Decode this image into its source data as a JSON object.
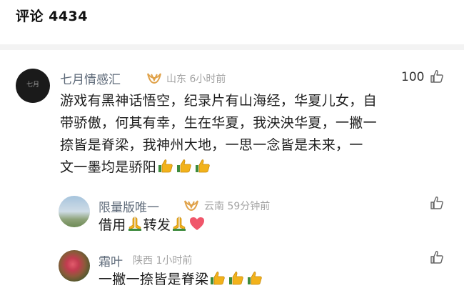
{
  "header": {
    "title": "评论 4434"
  },
  "icons": {
    "vip": "vip-badge-icon",
    "like": "thumbs-up-icon",
    "clap": "thumbs-up-emoji",
    "pray": "pray-emoji",
    "heart": "heart-emoji"
  },
  "comments": [
    {
      "avatar_text": "七月",
      "name": "七月情感汇",
      "location_time": "山东 6小时前",
      "likes": "100",
      "lines": [
        "游戏有黑神话悟空，纪录片有山海经，华夏儿女，自",
        "带骄傲，何其有幸，生在华夏，我泱泱华夏，一撇一",
        "捺皆是脊梁，我神州大地，一思一念皆是未来，一",
        "文一墨均是骄阳"
      ]
    },
    {
      "name": "限量版唯一",
      "location_time": "云南 59分钟前",
      "text_a": "借用",
      "text_b": "转发"
    },
    {
      "name": "霜叶",
      "location_time": "陕西 1小时前",
      "text": "一撇一捺皆是脊梁"
    }
  ],
  "colors": {
    "name": "#5f6b7a",
    "meta": "#a3a3a3",
    "vip": "#e0a24a",
    "thumb": "#f2b21b",
    "heart": "#f0566a"
  }
}
